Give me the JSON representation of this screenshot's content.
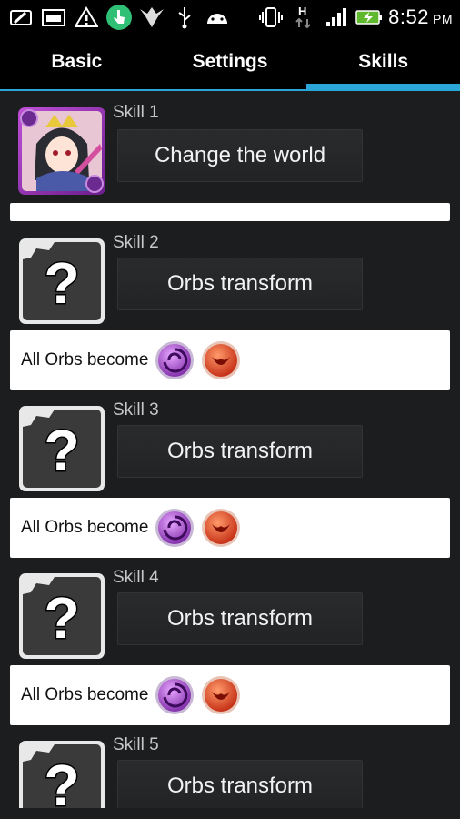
{
  "status_bar": {
    "time": "8:52",
    "ampm": "PM",
    "icons": [
      "photo-edit-icon",
      "gallery-icon",
      "warning-icon",
      "touch-app-icon",
      "bird-logo-icon",
      "usb-icon",
      "android-icon",
      "vibrate-icon",
      "h-data-icon",
      "signal-icon",
      "battery-charging-icon"
    ]
  },
  "tabs": [
    {
      "label": "Basic",
      "active": false
    },
    {
      "label": "Settings",
      "active": false
    },
    {
      "label": "Skills",
      "active": true
    }
  ],
  "skills": [
    {
      "label": "Skill 1",
      "button": "Change the world",
      "thumb": "character-portrait",
      "description": ""
    },
    {
      "label": "Skill 2",
      "button": "Orbs transform",
      "thumb": "unknown-question",
      "description": "All Orbs become",
      "orbs": [
        "dark-orb-icon",
        "fire-orb-icon"
      ]
    },
    {
      "label": "Skill 3",
      "button": "Orbs transform",
      "thumb": "unknown-question",
      "description": "All Orbs become",
      "orbs": [
        "dark-orb-icon",
        "fire-orb-icon"
      ]
    },
    {
      "label": "Skill 4",
      "button": "Orbs transform",
      "thumb": "unknown-question",
      "description": "All Orbs become",
      "orbs": [
        "dark-orb-icon",
        "fire-orb-icon"
      ]
    },
    {
      "label": "Skill 5",
      "button": "Orbs transform",
      "thumb": "unknown-question",
      "description": "",
      "orbs": []
    }
  ],
  "colors": {
    "accent": "#2aa6d8",
    "background": "#1c1d1f",
    "dark_orb": "#9b3fc8",
    "fire_orb": "#e0482a"
  }
}
